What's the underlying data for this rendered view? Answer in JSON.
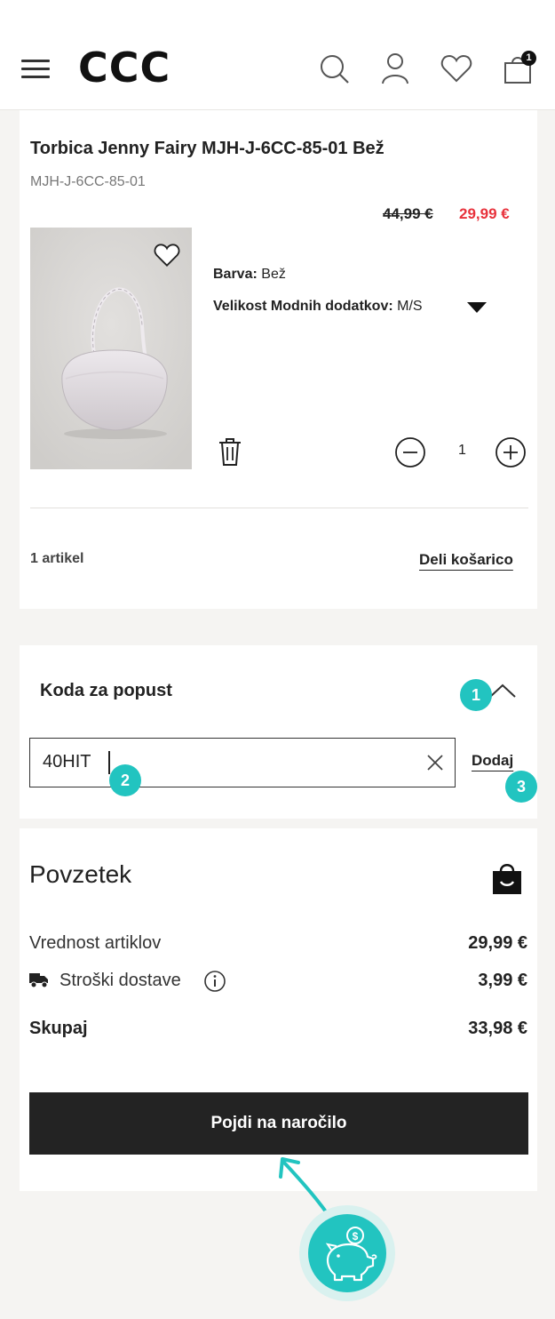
{
  "header": {
    "logo": "CCC",
    "cart_count": "1",
    "icons": [
      "menu-icon",
      "search-icon",
      "user-icon",
      "heart-icon",
      "bag-icon"
    ]
  },
  "product": {
    "title": "Torbica Jenny Fairy MJH-J-6CC-85-01 Bež",
    "sku": "MJH-J-6CC-85-01",
    "price_old": "44,99 €",
    "price_new": "29,99 €",
    "color_label": "Barva:",
    "color_value": "Bež",
    "size_label": "Velikost Modnih dodatkov:",
    "size_value": "M/S",
    "quantity": "1",
    "item_count": "1 artikel",
    "share_link": "Deli košarico"
  },
  "discount": {
    "title": "Koda za popust",
    "input_value": "40HIT",
    "add_label": "Dodaj",
    "callouts": [
      "1",
      "2",
      "3"
    ]
  },
  "summary": {
    "title": "Povzetek",
    "rows": [
      {
        "label": "Vrednost artiklov",
        "value": "29,99 €"
      },
      {
        "label": "Stroški dostave",
        "value": "3,99 €"
      }
    ],
    "total_label": "Skupaj",
    "total_value": "33,98 €",
    "cta": "Pojdi na naročilo"
  },
  "colors": {
    "accent": "#22c4c0",
    "sale_price": "#e8323c",
    "cta_bg": "#232323"
  }
}
